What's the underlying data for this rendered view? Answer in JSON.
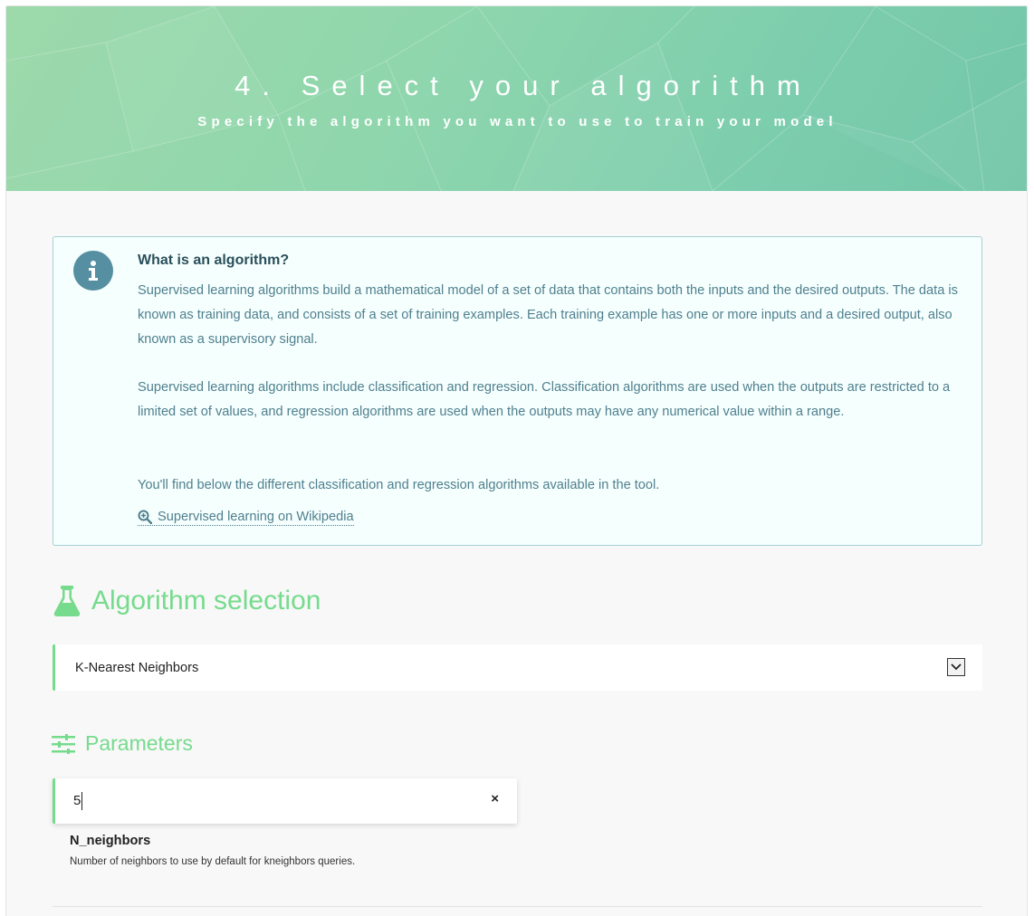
{
  "hero": {
    "title": "4. Select your algorithm",
    "subtitle": "Specify the algorithm you want to use to train your model"
  },
  "info": {
    "icon": "info-icon",
    "title": "What is an algorithm?",
    "paragraphs": [
      "Supervised learning algorithms build a mathematical model of a set of data that contains both the inputs and the desired outputs. The data is known as training data, and consists of a set of training examples. Each training example has one or more inputs and a desired output, also known as a supervisory signal.",
      "Supervised learning algorithms include classification and regression. Classification algorithms are used when the outputs are restricted to a limited set of values, and regression algorithms are used when the outputs may have any numerical value within a range.",
      "You'll find below the different classification and regression algorithms available in the tool."
    ],
    "link": {
      "icon": "zoom-in-icon",
      "label": "Supervised learning on Wikipedia"
    }
  },
  "algorithm": {
    "icon": "flask-icon",
    "heading": "Algorithm selection",
    "selected": "K-Nearest Neighbors"
  },
  "parameters": {
    "icon": "sliders-icon",
    "heading": "Parameters",
    "items": [
      {
        "value": "5",
        "name": "N_neighbors",
        "description": "Number of neighbors to use by default for kneighbors queries.",
        "clear_label": "×"
      }
    ]
  },
  "colors": {
    "accent": "#76db8d",
    "info_text": "#4f7f8e",
    "info_border": "#a7cfd3",
    "info_icon_bg": "#558fa1"
  }
}
